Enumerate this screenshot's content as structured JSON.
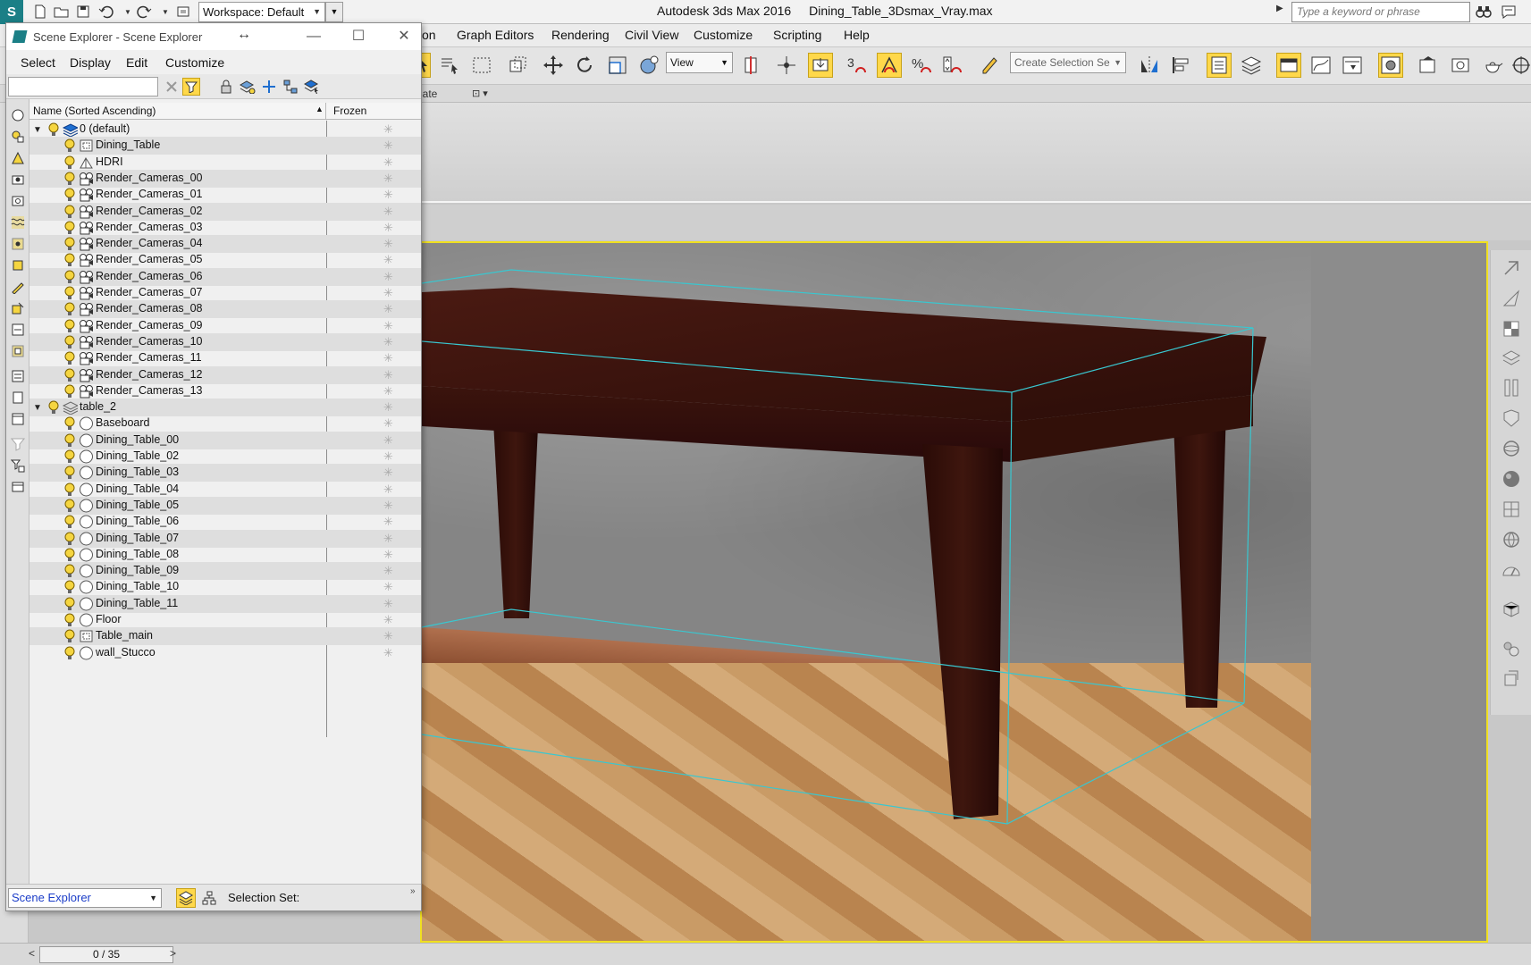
{
  "titlebar": {
    "workspace": "Workspace: Default",
    "app_name": "Autodesk 3ds Max 2016",
    "file_name": "Dining_Table_3Dsmax_Vray.max",
    "search_placeholder": "Type a keyword or phrase"
  },
  "menubar": {
    "items": [
      "on",
      "Graph Editors",
      "Rendering",
      "Civil View",
      "Customize",
      "Scripting",
      "Help"
    ]
  },
  "toolbar": {
    "view_combo": "View",
    "snap_number": "3",
    "selection_set_placeholder": "Create Selection Se"
  },
  "ribbon": {
    "text": "late"
  },
  "explorer": {
    "title": "Scene Explorer - Scene Explorer",
    "menu": [
      "Select",
      "Display",
      "Edit",
      "Customize"
    ],
    "columns": {
      "name": "Name (Sorted Ascending)",
      "frozen": "Frozen"
    },
    "rows": [
      {
        "label": "0 (default)",
        "type": "layer-active",
        "depth": 0
      },
      {
        "label": "Dining_Table",
        "type": "group",
        "depth": 1
      },
      {
        "label": "HDRI",
        "type": "light",
        "depth": 1
      },
      {
        "label": "Render_Cameras_00",
        "type": "camera",
        "depth": 1
      },
      {
        "label": "Render_Cameras_01",
        "type": "camera",
        "depth": 1
      },
      {
        "label": "Render_Cameras_02",
        "type": "camera",
        "depth": 1
      },
      {
        "label": "Render_Cameras_03",
        "type": "camera",
        "depth": 1
      },
      {
        "label": "Render_Cameras_04",
        "type": "camera",
        "depth": 1
      },
      {
        "label": "Render_Cameras_05",
        "type": "camera",
        "depth": 1
      },
      {
        "label": "Render_Cameras_06",
        "type": "camera",
        "depth": 1
      },
      {
        "label": "Render_Cameras_07",
        "type": "camera",
        "depth": 1
      },
      {
        "label": "Render_Cameras_08",
        "type": "camera",
        "depth": 1
      },
      {
        "label": "Render_Cameras_09",
        "type": "camera",
        "depth": 1
      },
      {
        "label": "Render_Cameras_10",
        "type": "camera",
        "depth": 1
      },
      {
        "label": "Render_Cameras_11",
        "type": "camera",
        "depth": 1
      },
      {
        "label": "Render_Cameras_12",
        "type": "camera",
        "depth": 1
      },
      {
        "label": "Render_Cameras_13",
        "type": "camera",
        "depth": 1
      },
      {
        "label": "table_2",
        "type": "layer",
        "depth": 0
      },
      {
        "label": "Baseboard",
        "type": "geometry",
        "depth": 1
      },
      {
        "label": "Dining_Table_00",
        "type": "geometry",
        "depth": 1
      },
      {
        "label": "Dining_Table_02",
        "type": "geometry",
        "depth": 1
      },
      {
        "label": "Dining_Table_03",
        "type": "geometry",
        "depth": 1
      },
      {
        "label": "Dining_Table_04",
        "type": "geometry",
        "depth": 1
      },
      {
        "label": "Dining_Table_05",
        "type": "geometry",
        "depth": 1
      },
      {
        "label": "Dining_Table_06",
        "type": "geometry",
        "depth": 1
      },
      {
        "label": "Dining_Table_07",
        "type": "geometry",
        "depth": 1
      },
      {
        "label": "Dining_Table_08",
        "type": "geometry",
        "depth": 1
      },
      {
        "label": "Dining_Table_09",
        "type": "geometry",
        "depth": 1
      },
      {
        "label": "Dining_Table_10",
        "type": "geometry",
        "depth": 1
      },
      {
        "label": "Dining_Table_11",
        "type": "geometry",
        "depth": 1
      },
      {
        "label": "Floor",
        "type": "geometry",
        "depth": 1
      },
      {
        "label": "Table_main",
        "type": "group",
        "depth": 1
      },
      {
        "label": "wall_Stucco",
        "type": "geometry",
        "depth": 1
      }
    ],
    "bottom": {
      "explorer_combo": "Scene Explorer",
      "selection_set_label": "Selection Set:"
    }
  },
  "statusbar": {
    "time": "0 / 35"
  },
  "colors": {
    "accent_active": "#ffd84a",
    "viewport_border": "#f0e020",
    "selection_box": "#39c7d0",
    "app_brand": "#1b7f86"
  }
}
